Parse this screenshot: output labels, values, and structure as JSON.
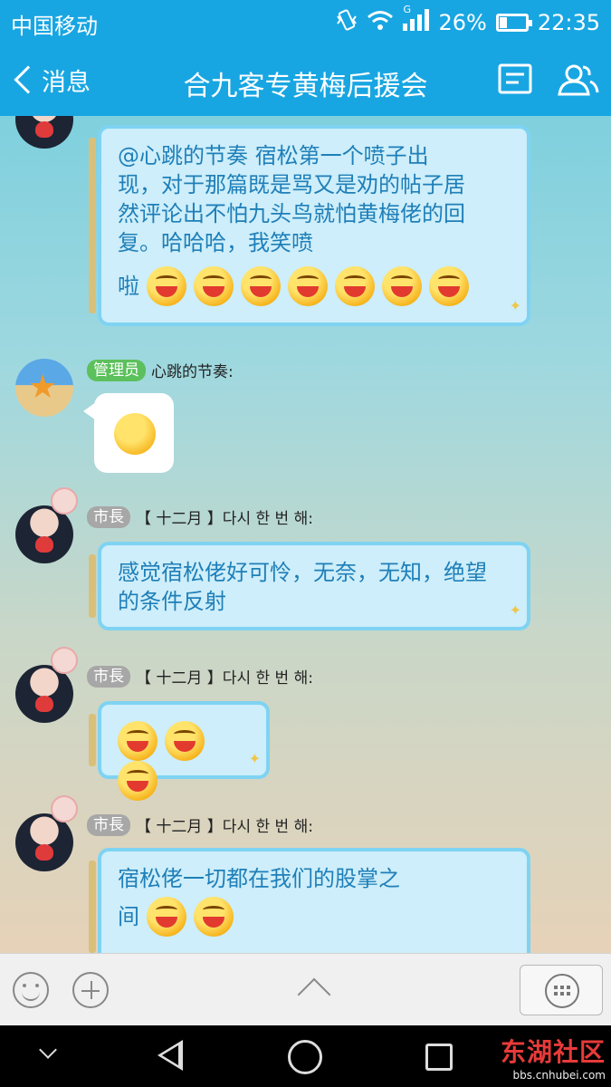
{
  "status_bar": {
    "carrier": "中国移动",
    "network_type": "G",
    "battery": "26%",
    "time": "22:35"
  },
  "header": {
    "back_label": "消息",
    "title": "合九客专黄梅后援会"
  },
  "messages": [
    {
      "text": "@心跳的节奏 宿松第一个喷子出现，对于那篇既是骂又是劝的帖子居然评论出不怕九头鸟就怕黄梅佬的回复。哈哈哈，我笑喷",
      "tail_text": "啦",
      "emoji_count": 7
    },
    {
      "badge": "管理员",
      "sender": "心跳的节奏:",
      "type": "sticker"
    },
    {
      "badge": "市長",
      "sender": "【 十二月 】다시 한 번 해:",
      "text": "感觉宿松佬好可怜，无奈，无知，绝望的条件反射"
    },
    {
      "badge": "市長",
      "sender": "【 十二月 】다시 한 번 해:",
      "emoji_count": 3
    },
    {
      "badge": "市長",
      "sender": "【 十二月 】다시 한 번 해:",
      "text": "宿松佬一切都在我们的股掌之",
      "tail_text": "间",
      "emoji_count": 2
    }
  ],
  "watermark": {
    "logo": "东湖社区",
    "url": "bbs.cnhubei.com"
  },
  "colors": {
    "header_bg": "#18a6e2",
    "bubble_text": "#1f7fb8",
    "admin_badge": "#5cc05c",
    "city_badge": "#a7a7a7"
  }
}
